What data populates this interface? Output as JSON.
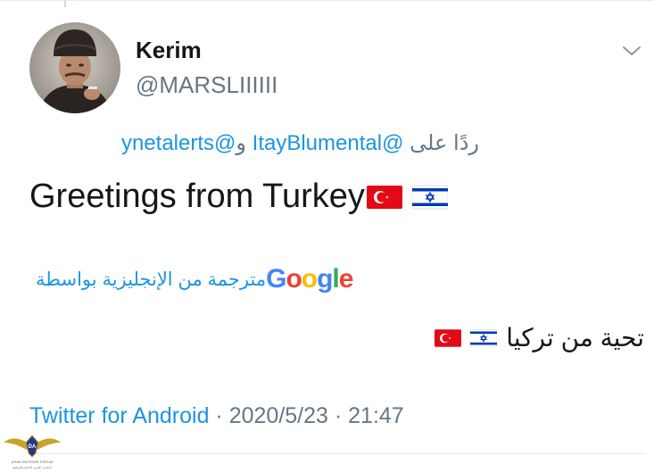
{
  "author": {
    "name": "Kerim",
    "handle": "@MARSLIIIIII"
  },
  "reply": {
    "prefix": "ردًا على",
    "mention_1": "@ItayBlumental",
    "connector": "و",
    "mention_2": "@ynetalerts"
  },
  "tweet": {
    "text": "Greetings from Turkey",
    "flags": [
      "turkey-flag",
      "israel-flag"
    ]
  },
  "translation": {
    "label": "مترجمة من الإنجليزية بواسطة",
    "provider": "Google",
    "provider_letters": [
      "G",
      "o",
      "o",
      "g",
      "l",
      "e"
    ],
    "provider_colors": [
      "#4285f4",
      "#ea4335",
      "#fbbc05",
      "#4285f4",
      "#34a853",
      "#ea4335"
    ],
    "text": "تحية من تركيا"
  },
  "meta": {
    "source": "Twitter for Android",
    "separator_1": " · ",
    "date": "2020/5/23",
    "separator_2": " · ",
    "time": "21:47"
  },
  "watermark": {
    "lines": [
      "DA",
      "ARAB DEFENSE FORUM",
      "المنتدى العربي للدفاع والتسليح"
    ]
  },
  "colors": {
    "link": "#1b95e0",
    "secondary_text": "#657786",
    "primary_text": "#14171a",
    "divider": "#e6ecf0",
    "turkey_red": "#e30a17",
    "israel_blue": "#0038b8"
  }
}
